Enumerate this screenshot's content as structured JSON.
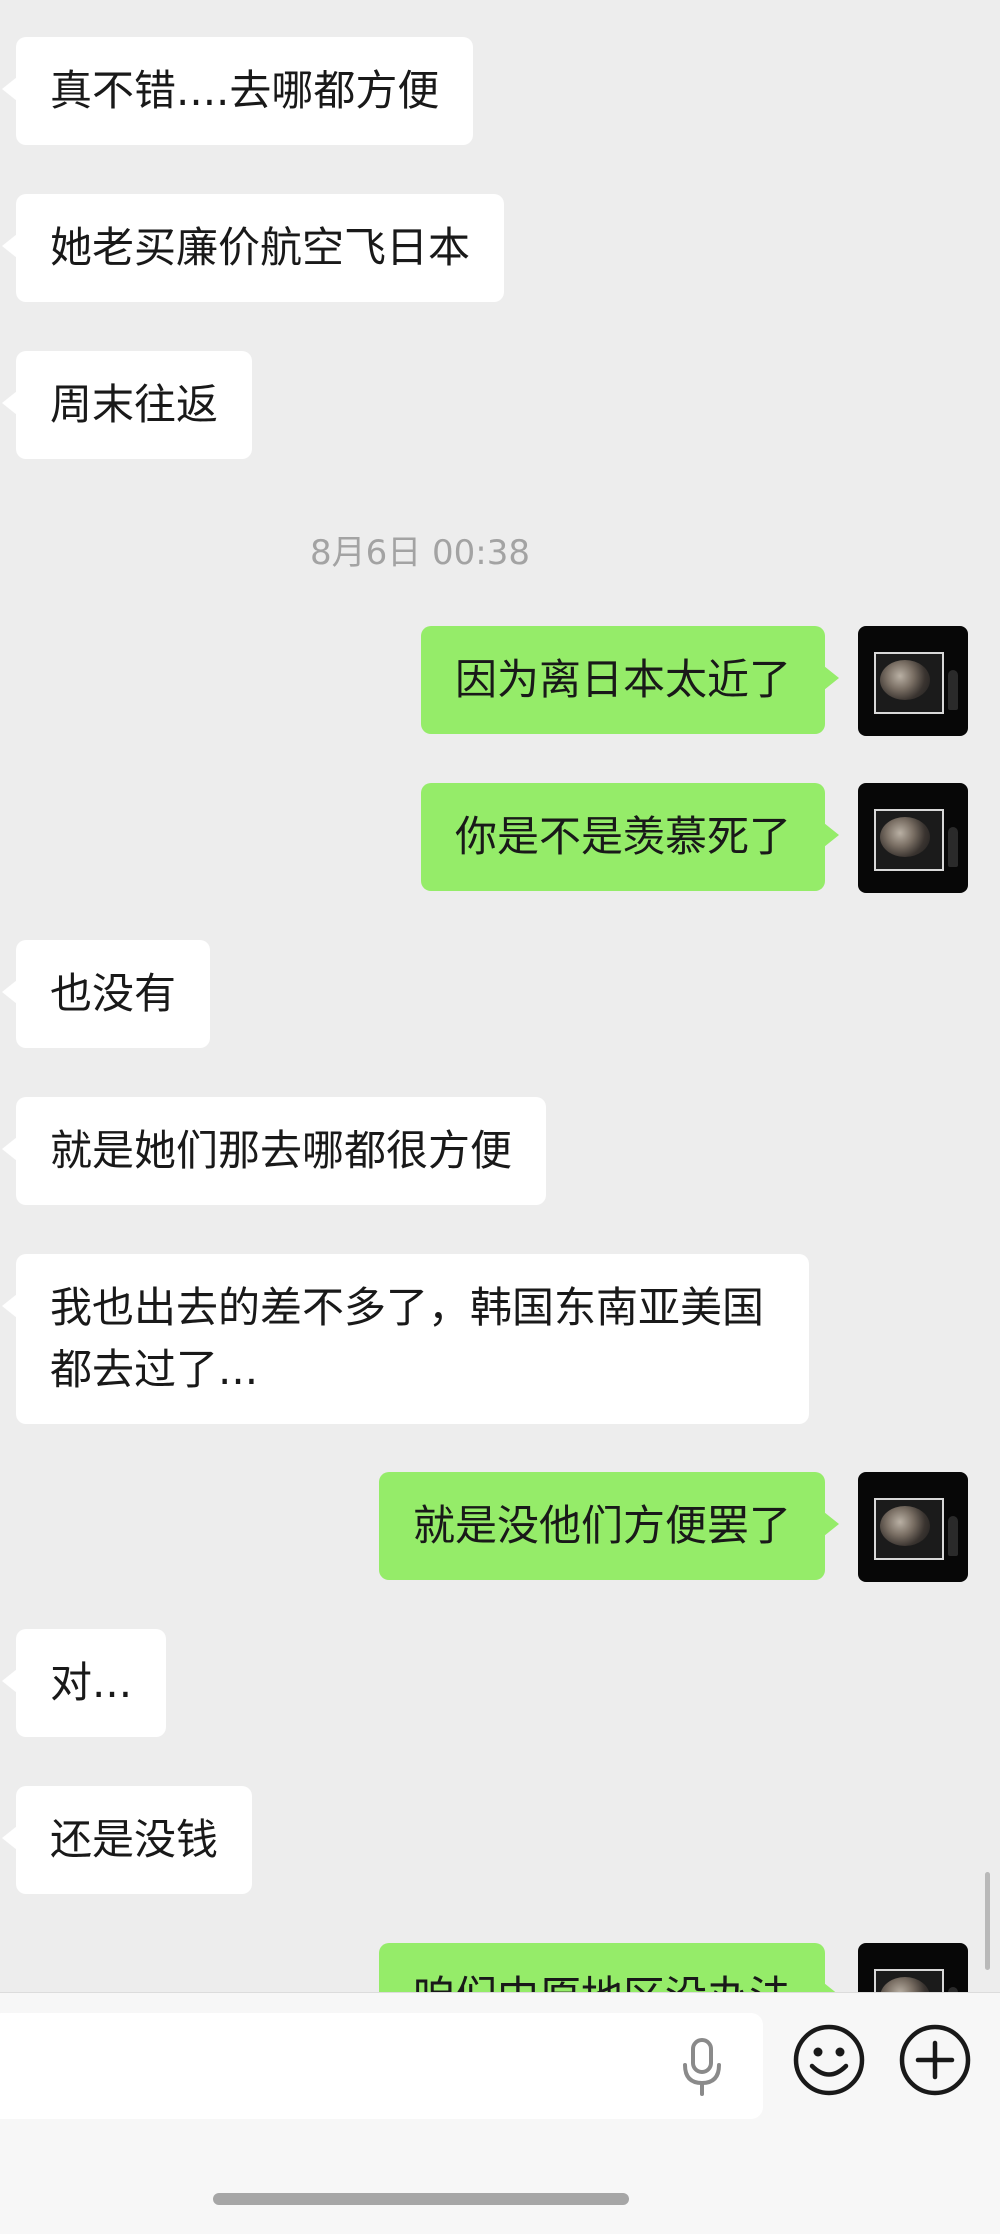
{
  "messages": [
    {
      "side": "left",
      "text": "真不错....去哪都方便"
    },
    {
      "side": "left",
      "text": "她老买廉价航空飞日本"
    },
    {
      "side": "left",
      "text": "周末往返"
    },
    {
      "timestamp": "8月6日 00:38"
    },
    {
      "side": "right",
      "text": "因为离日本太近了"
    },
    {
      "side": "right",
      "text": "你是不是羡慕死了"
    },
    {
      "side": "left",
      "text": "也没有"
    },
    {
      "side": "left",
      "text": "就是她们那去哪都很方便"
    },
    {
      "side": "left",
      "text": "我也出去的差不多了，韩国东南亚美国都去过了..."
    },
    {
      "side": "right",
      "text": "就是没他们方便罢了"
    },
    {
      "side": "left",
      "text": "对..."
    },
    {
      "side": "left",
      "text": "还是没钱"
    },
    {
      "side": "right",
      "text": "咱们中原地区没办法",
      "partially_visible": true
    }
  ],
  "input": {
    "value": "",
    "placeholder": ""
  },
  "icons": {
    "mic": "mic-icon",
    "emoji": "emoji-icon",
    "more": "plus-icon"
  },
  "colors": {
    "background": "#ededed",
    "left_bubble": "#ffffff",
    "right_bubble": "#95ec69",
    "timestamp": "#a3a3a3"
  }
}
